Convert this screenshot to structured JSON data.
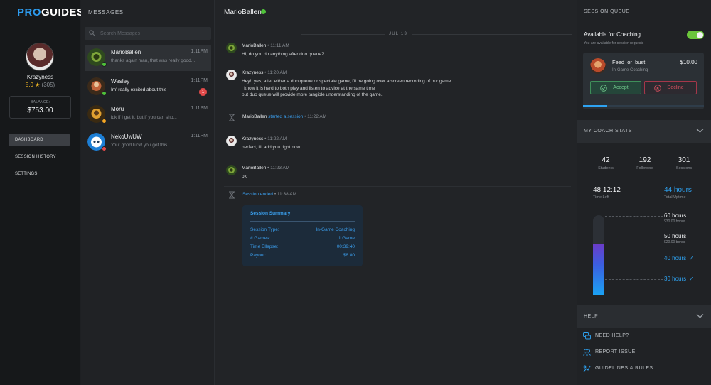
{
  "brand": {
    "logo_a": "PRO",
    "logo_b": "GUIDES"
  },
  "profile": {
    "username": "Krazyness",
    "rating": "5.0 ★",
    "reviews": "(305)",
    "balance_label": "BALANCE:",
    "balance_value": "$753.00"
  },
  "nav": [
    {
      "label": "DASHBOARD",
      "active": true
    },
    {
      "label": "SESSION HISTORY",
      "active": false
    },
    {
      "label": "SETTINGS",
      "active": false
    }
  ],
  "messages_panel": {
    "title": "MESSAGES",
    "search_placeholder": "Search Messages",
    "conversations": [
      {
        "name": "MarioBallen",
        "time": "1:11PM",
        "snippet": "thanks again man, that was really good...",
        "status": "online",
        "unread": ""
      },
      {
        "name": "Wesley",
        "time": "1:11PM",
        "snippet": "Im' really excited about this",
        "status": "online",
        "unread": "1"
      },
      {
        "name": "Moru",
        "time": "1:11PM",
        "snippet": "idk if I get it, but if you can sho...",
        "status": "away",
        "unread": ""
      },
      {
        "name": "NekoUwUW",
        "time": "1:11PM",
        "snippet": "You: good luck! you got this",
        "status": "busy",
        "unread": ""
      }
    ]
  },
  "chat": {
    "contact": "MarioBallen",
    "date": "JUL 13",
    "messages": [
      {
        "author": "MarioBallen",
        "time": "11:11 AM",
        "lines": [
          "Hi, do you do anything after duo queue?"
        ]
      },
      {
        "author": "Krazyness",
        "time": "11:20 AM",
        "lines": [
          "Hey!! yes, after either a duo queue or spectate game, i'll be going over a screen recording of our game.",
          "i know it is hard to both play and listen to advice at the same time",
          "but duo queue will provide more tangible understanding of the game."
        ]
      },
      {
        "author": "Krazyness",
        "time": "11:22 AM",
        "lines": [
          "perfect, i'll add you right now"
        ]
      },
      {
        "author": "MarioBallen",
        "time": "11:23 AM",
        "lines": [
          "ok"
        ]
      }
    ],
    "system_started": {
      "author": "MarioBallen",
      "action": "started a session",
      "time": "11:22 AM"
    },
    "system_ended": {
      "action": "Session ended",
      "time": "11:38 AM"
    },
    "summary": {
      "title": "Session Summary",
      "rows": [
        {
          "label": "Session Type:",
          "value": "In-Game Coaching"
        },
        {
          "label": "# Games:",
          "value": "1 Game"
        },
        {
          "label": "Time Ellapse:",
          "value": "00:39:40"
        },
        {
          "label": "Payout:",
          "value": "$8.80"
        }
      ]
    }
  },
  "queue": {
    "title": "SESSION QUEUE",
    "available_label": "Available for Coaching",
    "available_sub": "You are available for session requests",
    "available_on": true,
    "request": {
      "name": "Feed_or_bust",
      "price": "$10.00",
      "type": "In-Game Coaching",
      "accept": "Accept",
      "decline": "Decline",
      "progress": 0.2
    }
  },
  "coach_stats": {
    "title": "MY COACH STATS",
    "students": "42",
    "students_label": "Students",
    "followers": "192",
    "followers_label": "Followers",
    "sessions": "301",
    "sessions_label": "Sessions",
    "time_left": "48:12:12",
    "time_left_label": "Time Left",
    "uptime": "44 hours",
    "uptime_label": "Total Uptime",
    "gauge_fraction": 0.64,
    "tiers": [
      {
        "hours": "60 hours",
        "bonus": "$30.00 bonus",
        "reached": false
      },
      {
        "hours": "50 hours",
        "bonus": "$20.00 bonus",
        "reached": false
      },
      {
        "hours": "40 hours",
        "bonus": "",
        "reached": true
      },
      {
        "hours": "30 hours",
        "bonus": "",
        "reached": true
      }
    ]
  },
  "help": {
    "title": "HELP",
    "items": [
      {
        "label": "NEED HELP?",
        "icon": "chat-bubbles-icon"
      },
      {
        "label": "REPORT ISSUE",
        "icon": "people-icon"
      },
      {
        "label": "GUIDELINES & RULES",
        "icon": "guidelines-icon"
      }
    ]
  },
  "colors": {
    "accent": "#2ea3f2",
    "online": "#4fc23a",
    "away": "#f5a623",
    "busy": "#e24a4a",
    "accept": "#6ec48a",
    "decline": "#d8505f"
  }
}
